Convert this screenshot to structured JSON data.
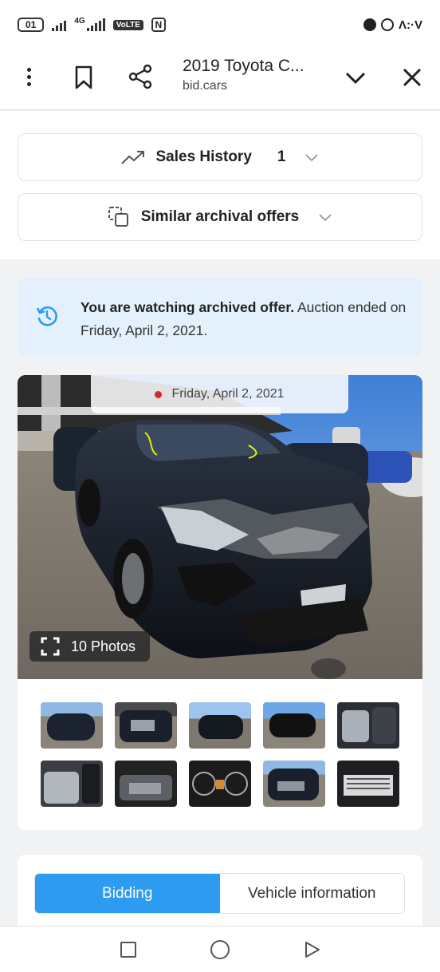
{
  "status_bar": {
    "sim": "01",
    "network": "4G",
    "volte": "VoLTE",
    "nfc": "N",
    "right_text": "Λ:·V"
  },
  "browser": {
    "title": "2019 Toyota C...",
    "domain": "bid.cars",
    "icons": [
      "more-vert-icon",
      "bookmark-icon",
      "share-icon",
      "chevron-down-icon",
      "close-icon"
    ]
  },
  "sections": {
    "sales_history_label": "Sales History",
    "sales_history_count": "1",
    "similar_offers_label": "Similar archival offers"
  },
  "notice": {
    "bold": "You are watching archived offer.",
    "rest": " Auction ended on Friday, April 2, 2021."
  },
  "gallery": {
    "date": "Friday, April 2, 2021",
    "photos_label": "10 Photos",
    "thumbnail_count": 10
  },
  "tabs": {
    "bidding": "Bidding",
    "vehicle_info": "Vehicle information",
    "active": "Bidding"
  },
  "colors": {
    "accent": "#2c9bf0",
    "notice_bg": "#e4f1fc",
    "date_dot": "#d62828"
  }
}
